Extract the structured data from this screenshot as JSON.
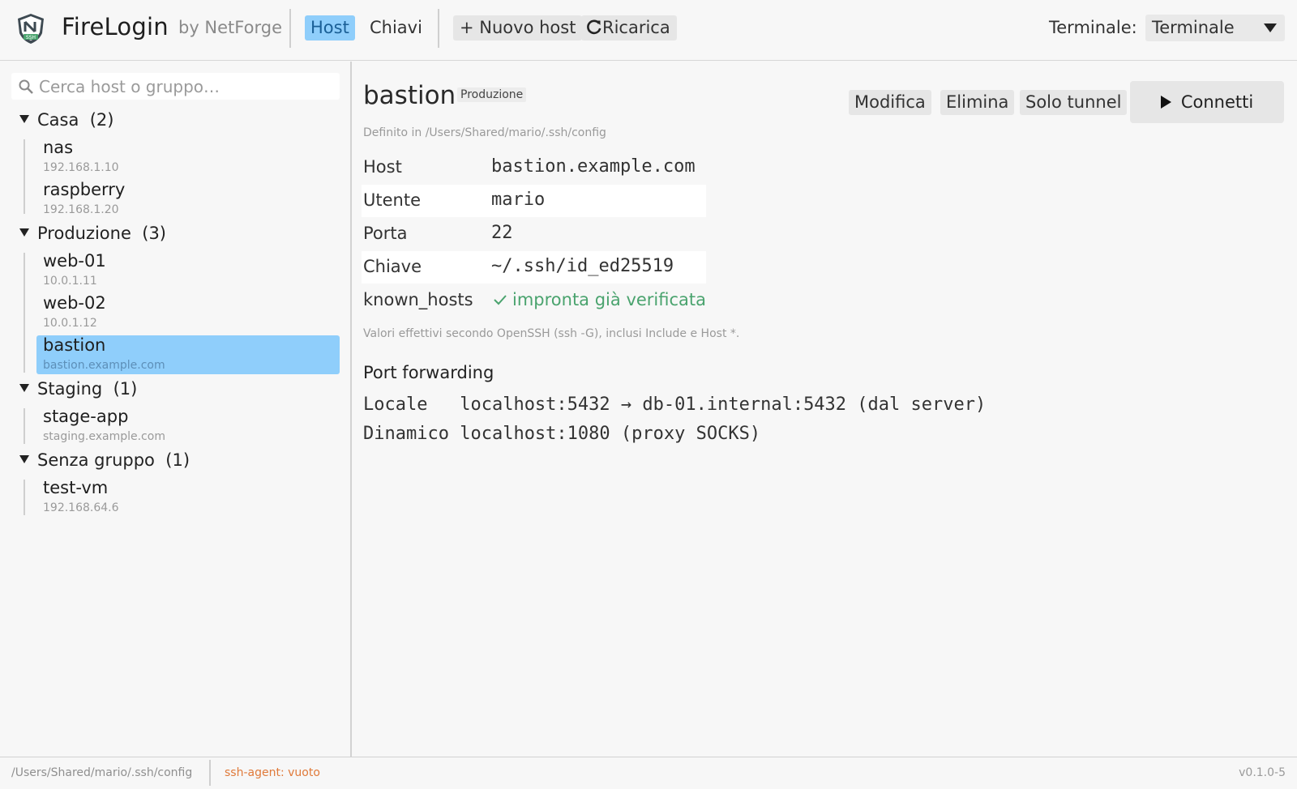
{
  "app": {
    "name": "FireLogin",
    "by": "by NetForge",
    "logo_text": "SSH"
  },
  "nav": {
    "tab_host": "Host",
    "tab_keys": "Chiavi",
    "new_host": "+ Nuovo host",
    "reload": "Ricarica"
  },
  "terminal": {
    "label": "Terminale:",
    "selected": "Terminale"
  },
  "search": {
    "placeholder": "Cerca host o gruppo…"
  },
  "groups": [
    {
      "label": "Casa",
      "count": "(2)",
      "hosts": [
        {
          "name": "nas",
          "addr": "192.168.1.10"
        },
        {
          "name": "raspberry",
          "addr": "192.168.1.20"
        }
      ]
    },
    {
      "label": "Produzione",
      "count": "(3)",
      "hosts": [
        {
          "name": "web-01",
          "addr": "10.0.1.11"
        },
        {
          "name": "web-02",
          "addr": "10.0.1.12"
        },
        {
          "name": "bastion",
          "addr": "bastion.example.com",
          "selected": true
        }
      ]
    },
    {
      "label": "Staging",
      "count": "(1)",
      "hosts": [
        {
          "name": "stage-app",
          "addr": "staging.example.com"
        }
      ]
    },
    {
      "label": "Senza gruppo",
      "count": "(1)",
      "hosts": [
        {
          "name": "test-vm",
          "addr": "192.168.64.6"
        }
      ]
    }
  ],
  "detail": {
    "title": "bastion",
    "group_badge": "Produzione",
    "defined_in": "Definito in /Users/Shared/mario/.ssh/config",
    "buttons": {
      "edit": "Modifica",
      "delete": "Elimina",
      "tunnel": "Solo tunnel",
      "connect": "Connetti"
    },
    "fields": [
      {
        "key": "Host",
        "value": "bastion.example.com"
      },
      {
        "key": "Utente",
        "value": "mario"
      },
      {
        "key": "Porta",
        "value": "22"
      },
      {
        "key": "Chiave",
        "value": "~/.ssh/id_ed25519"
      }
    ],
    "known_hosts": {
      "key": "known_hosts",
      "value": "impronta già verificata"
    },
    "note": "Valori effettivi secondo OpenSSH (ssh -G), inclusi Include e Host *.",
    "port_forwarding": {
      "title": "Port forwarding",
      "rules": [
        {
          "type": "Locale  ",
          "desc": "localhost:5432 → db-01.internal:5432 (dal server)"
        },
        {
          "type": "Dinamico",
          "desc": "localhost:1080 (proxy SOCKS)"
        }
      ]
    }
  },
  "status": {
    "path": "/Users/Shared/mario/.ssh/config",
    "agent": "ssh-agent: vuoto",
    "version": "v0.1.0-5"
  },
  "colors": {
    "accent": "#8fcefb",
    "ok": "#4aa36e",
    "warn": "#e07a3a"
  }
}
